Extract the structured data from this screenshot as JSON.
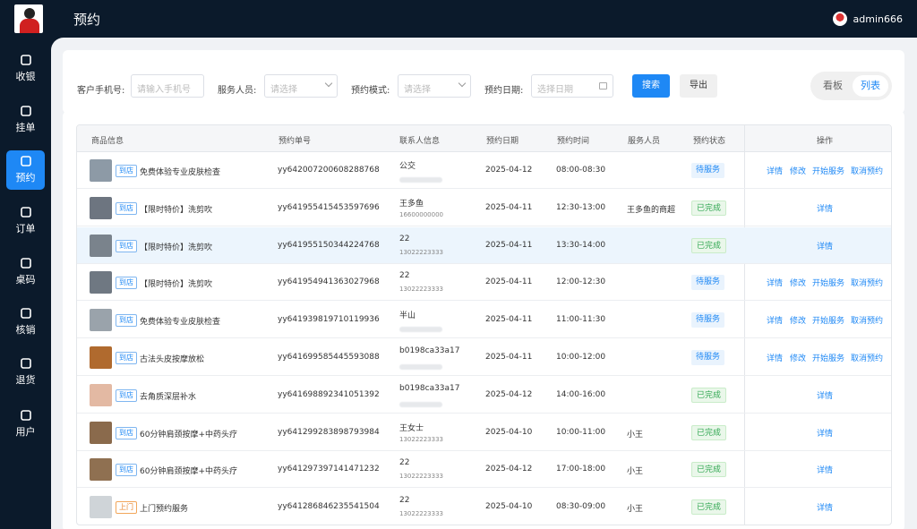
{
  "header": {
    "title": "预约",
    "username": "admin666"
  },
  "sidebar": {
    "items": [
      {
        "label": "收银",
        "icon": "cashier-icon"
      },
      {
        "label": "挂单",
        "icon": "pending-order-icon"
      },
      {
        "label": "预约",
        "icon": "clock-icon",
        "active": true
      },
      {
        "label": "订单",
        "icon": "clipboard-icon"
      },
      {
        "label": "桌码",
        "icon": "qr-code-icon"
      },
      {
        "label": "核销",
        "icon": "verify-icon"
      },
      {
        "label": "退货",
        "icon": "return-icon"
      },
      {
        "label": "用户",
        "icon": "user-icon"
      }
    ]
  },
  "filters": {
    "phone_label": "客户手机号:",
    "phone_placeholder": "请输入手机号",
    "staff_label": "服务人员:",
    "staff_placeholder": "请选择",
    "mode_label": "预约模式:",
    "mode_placeholder": "请选择",
    "date_label": "预约日期:",
    "date_placeholder": "选择日期",
    "search_label": "搜索",
    "export_label": "导出",
    "view_board": "看板",
    "view_list": "列表"
  },
  "table": {
    "headers": [
      "商品信息",
      "预约单号",
      "联系人信息",
      "预约日期",
      "预约时间",
      "服务人员",
      "预约状态",
      "操作"
    ],
    "rows": [
      {
        "tag": "到店",
        "product": "免费体验专业皮肤检查",
        "order_no": "yy642007200608288768",
        "contact_name": "公交",
        "contact_phone": "",
        "date": "2025-04-12",
        "time": "08:00-08:30",
        "staff": "",
        "status": "待服务",
        "ops": [
          "详情",
          "修改",
          "开始服务",
          "取消预约"
        ]
      },
      {
        "tag": "到店",
        "product": "【限时特价】洗剪吹",
        "order_no": "yy641955415453597696",
        "contact_name": "王多鱼",
        "contact_phone": "16600000000",
        "date": "2025-04-11",
        "time": "12:30-13:00",
        "staff": "王多鱼的商超",
        "status": "已完成",
        "ops": [
          "详情"
        ]
      },
      {
        "tag": "到店",
        "product": "【限时特价】洗剪吹",
        "order_no": "yy641955150344224768",
        "contact_name": "22",
        "contact_phone": "13022223333",
        "date": "2025-04-11",
        "time": "13:30-14:00",
        "staff": "",
        "status": "已完成",
        "ops": [
          "详情"
        ]
      },
      {
        "tag": "到店",
        "product": "【限时特价】洗剪吹",
        "order_no": "yy641954941363027968",
        "contact_name": "22",
        "contact_phone": "13022223333",
        "date": "2025-04-11",
        "time": "12:00-12:30",
        "staff": "",
        "status": "待服务",
        "ops": [
          "详情",
          "修改",
          "开始服务",
          "取消预约"
        ]
      },
      {
        "tag": "到店",
        "product": "免费体验专业皮肤检查",
        "order_no": "yy641939819710119936",
        "contact_name": "半山",
        "contact_phone": "",
        "date": "2025-04-11",
        "time": "11:00-11:30",
        "staff": "",
        "status": "待服务",
        "ops": [
          "详情",
          "修改",
          "开始服务",
          "取消预约"
        ]
      },
      {
        "tag": "到店",
        "product": "古法头皮按摩放松",
        "order_no": "yy641699585445593088",
        "contact_name": "b0198ca33a17",
        "contact_phone": "",
        "date": "2025-04-11",
        "time": "10:00-12:00",
        "staff": "",
        "status": "待服务",
        "ops": [
          "详情",
          "修改",
          "开始服务",
          "取消预约"
        ]
      },
      {
        "tag": "到店",
        "product": "去角质深层补水",
        "order_no": "yy641698892341051392",
        "contact_name": "b0198ca33a17",
        "contact_phone": "",
        "date": "2025-04-12",
        "time": "14:00-16:00",
        "staff": "",
        "status": "已完成",
        "ops": [
          "详情"
        ]
      },
      {
        "tag": "到店",
        "product": "60分钟肩颈按摩+中药头疗",
        "order_no": "yy641299283898793984",
        "contact_name": "王女士",
        "contact_phone": "13022223333",
        "date": "2025-04-10",
        "time": "10:00-11:00",
        "staff": "小王",
        "status": "已完成",
        "ops": [
          "详情"
        ]
      },
      {
        "tag": "到店",
        "product": "60分钟肩颈按摩+中药头疗",
        "order_no": "yy641297397141471232",
        "contact_name": "22",
        "contact_phone": "13022223333",
        "date": "2025-04-12",
        "time": "17:00-18:00",
        "staff": "小王",
        "status": "已完成",
        "ops": [
          "详情"
        ]
      },
      {
        "tag": "上门",
        "product": "上门预约服务",
        "order_no": "yy641286846235541504",
        "contact_name": "22",
        "contact_phone": "13022223333",
        "date": "2025-04-10",
        "time": "08:30-09:00",
        "staff": "小王",
        "status": "已完成",
        "ops": [
          "详情"
        ]
      }
    ]
  },
  "colors": {
    "accent": "#1e88f5",
    "sidebar_bg": "#0b1a2b",
    "done_green": "#33a853"
  }
}
